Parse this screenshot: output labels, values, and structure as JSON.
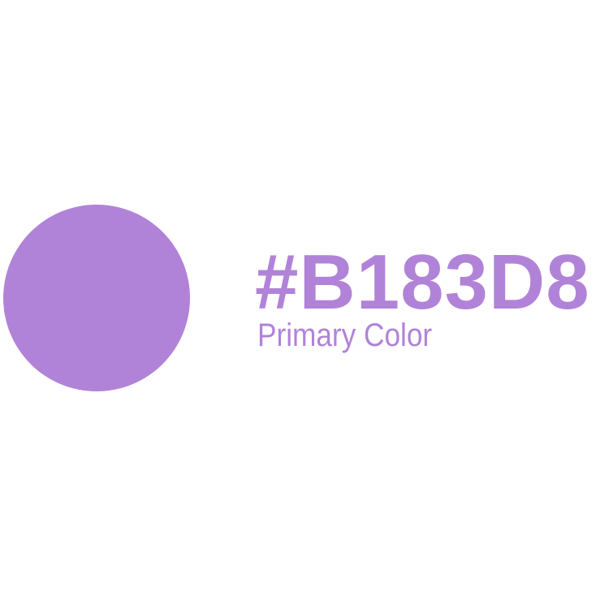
{
  "swatch": {
    "hex": "#B183D8",
    "label": "Primary Color"
  },
  "colors": {
    "swatch_fill": "#B183D8",
    "text": "#B183D8",
    "background": "#FFFFFF"
  }
}
